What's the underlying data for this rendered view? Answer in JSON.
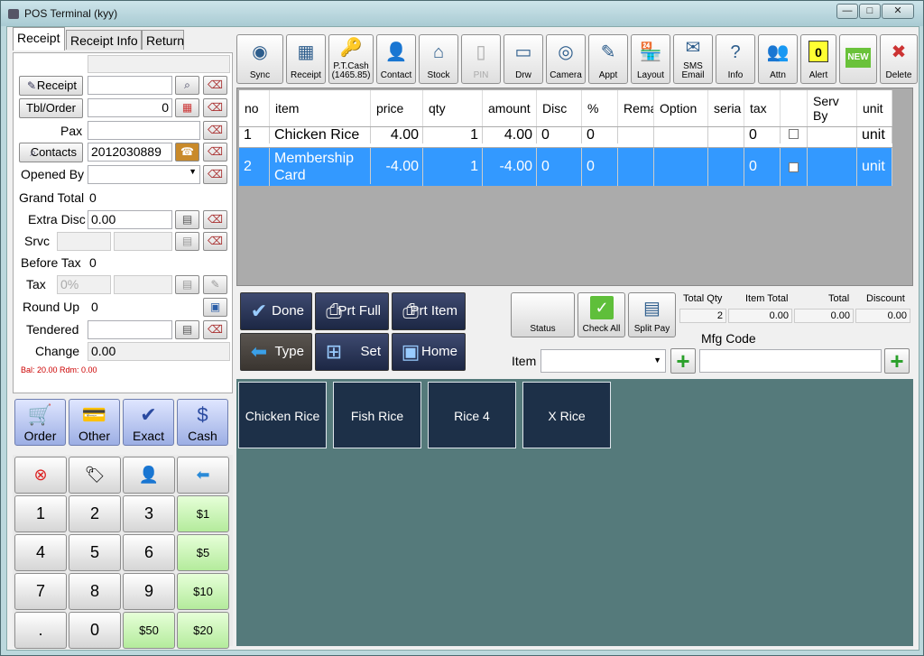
{
  "window": {
    "title": "POS Terminal (kyy)",
    "min": "—",
    "max": "□",
    "close": "✕"
  },
  "tabs": [
    "Receipt",
    "Receipt Info",
    "Return"
  ],
  "form": {
    "receipt_btn": "Receipt",
    "tbl_btn": "Tbl/Order",
    "tbl_value": "0",
    "pax_label": "Pax",
    "contacts_btn": "Contacts",
    "contact_value": "2012030889",
    "opened_by_label": "Opened By",
    "grand_total_label": "Grand Total",
    "grand_total_value": "0",
    "extra_disc_label": "Extra Disc",
    "extra_disc_value": "0.00",
    "srvc_label": "Srvc",
    "before_tax_label": "Before Tax",
    "before_tax_value": "0",
    "tax_label": "Tax",
    "tax_placeholder": "0%",
    "round_up_label": "Round Up",
    "round_up_value": "0",
    "tendered_label": "Tendered",
    "change_label": "Change",
    "change_value": "0.00",
    "balance_note": "Bal: 20.00 Rdm: 0.00"
  },
  "pay_buttons": [
    {
      "label": "Order",
      "icon": "cart-icon"
    },
    {
      "label": "Other",
      "icon": "cards-icon"
    },
    {
      "label": "Exact",
      "icon": "check-icon"
    },
    {
      "label": "Cash",
      "icon": "dollar-icon"
    }
  ],
  "keypad": {
    "row1_icons": [
      "cancel-icon",
      "price-tag-icon",
      "customer-icon",
      "backspace-icon"
    ],
    "keys": [
      "1",
      "2",
      "3",
      "$1",
      "4",
      "5",
      "6",
      "$5",
      "7",
      "8",
      "9",
      "$10",
      ".",
      "0",
      "$50",
      "$20"
    ]
  },
  "toolbar": [
    {
      "label": "Sync",
      "icon": "sync-icon"
    },
    {
      "label": "Receipt",
      "icon": "receipt-icon"
    },
    {
      "label": "P.T.Cash\n(1465.85)",
      "icon": "key-icon"
    },
    {
      "label": "Contact",
      "icon": "contact-icon"
    },
    {
      "label": "Stock",
      "icon": "house-icon"
    },
    {
      "label": "PIN",
      "icon": "phone-icon"
    },
    {
      "label": "Drw",
      "icon": "drawer-icon"
    },
    {
      "label": "Camera",
      "icon": "camera-icon"
    },
    {
      "label": "Appt",
      "icon": "appointment-icon"
    },
    {
      "label": "Layout",
      "icon": "shop-icon"
    },
    {
      "label": "SMS\nEmail",
      "icon": "email-icon"
    },
    {
      "label": "Info",
      "icon": "help-icon"
    },
    {
      "label": "Attn",
      "icon": "attendance-icon"
    },
    {
      "label": "Alert",
      "icon": "alert-icon",
      "badge": "0"
    },
    {
      "label": "",
      "icon": "new-icon",
      "badge": "NEW"
    },
    {
      "label": "Delete",
      "icon": "delete-icon"
    }
  ],
  "grid": {
    "columns": [
      "no",
      "item",
      "price",
      "qty",
      "amount",
      "Disc",
      "%",
      "Rema",
      "Option",
      "seria",
      "tax",
      "",
      "Serv By",
      "unit"
    ],
    "rows": [
      {
        "no": "1",
        "item": "Chicken Rice",
        "price": "4.00",
        "qty": "1",
        "amount": "4.00",
        "disc": "0",
        "pct": "0",
        "tax": "0",
        "unit": "unit"
      },
      {
        "no": "2",
        "item": "Membership Card",
        "price": "-4.00",
        "qty": "1",
        "amount": "-4.00",
        "disc": "0",
        "pct": "0",
        "tax": "0",
        "unit": "unit"
      }
    ]
  },
  "actions": [
    {
      "label": "Done",
      "icon": "checkmark-icon"
    },
    {
      "label": "Prt Full",
      "icon": "printer-icon"
    },
    {
      "label": "Prt Item",
      "icon": "printer-icon"
    },
    {
      "label": "Type",
      "icon": "arrow-left-icon"
    },
    {
      "label": "Set",
      "icon": "basket-icon"
    },
    {
      "label": "Home",
      "icon": "home-window-icon"
    }
  ],
  "status_btns": [
    {
      "label": "Status"
    },
    {
      "label": "Check All"
    },
    {
      "label": "Split Pay"
    }
  ],
  "summary": {
    "total_qty_label": "Total Qty",
    "total_qty": "2",
    "item_total_label": "Item Total",
    "item_total": "0.00",
    "total_label": "Total",
    "total": "0.00",
    "discount_label": "Discount",
    "discount": "0.00"
  },
  "item_label": "Item",
  "mfg_label": "Mfg Code",
  "menu_items": [
    "Chicken Rice",
    "Fish Rice",
    "Rice 4",
    "X Rice"
  ]
}
